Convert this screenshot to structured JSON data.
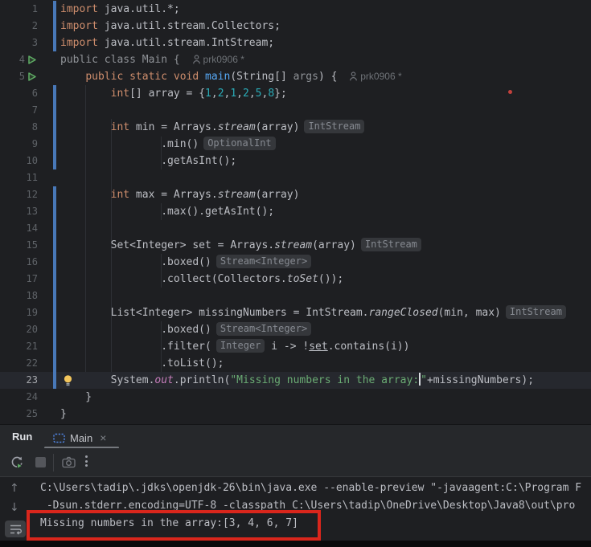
{
  "colors": {
    "editor_bg": "#1e1f22",
    "keyword": "#cf8e6d",
    "string": "#6aab73",
    "number": "#2aacb8",
    "method_decl": "#56a8f5",
    "static_field": "#c77dbb",
    "vcs_change_bar": "#4878b8",
    "run_green": "#5fad65",
    "annotation_red": "#d9261c",
    "current_line_bg": "#26282e"
  },
  "editor": {
    "author_label": "prk0906 *",
    "lines": [
      {
        "n": "1",
        "vcs": true,
        "segs": [
          {
            "s": "kw",
            "t": "import"
          },
          {
            "s": "def",
            "t": " java.util.*;"
          }
        ]
      },
      {
        "n": "2",
        "vcs": true,
        "segs": [
          {
            "s": "kw",
            "t": "import"
          },
          {
            "s": "def",
            "t": " java.util.stream.Collectors;"
          }
        ]
      },
      {
        "n": "3",
        "vcs": true,
        "segs": [
          {
            "s": "kw",
            "t": "import"
          },
          {
            "s": "def",
            "t": " java.util.stream.IntStream;"
          }
        ]
      },
      {
        "n": "4",
        "run": true,
        "segs": [
          {
            "s": "dim",
            "t": "public class Main { "
          },
          {
            "icon": "person-icon"
          },
          {
            "s": "author",
            "t": "prk0906 *"
          }
        ]
      },
      {
        "n": "5",
        "run": true,
        "segs": [
          {
            "s": "def",
            "t": "    "
          },
          {
            "s": "kw",
            "t": "public static void "
          },
          {
            "s": "fn",
            "t": "main"
          },
          {
            "s": "def",
            "t": "(String[] "
          },
          {
            "s": "dim",
            "t": "args"
          },
          {
            "s": "def",
            "t": ") { "
          },
          {
            "icon": "person-icon"
          },
          {
            "s": "author",
            "t": "prk0906 *"
          }
        ]
      },
      {
        "n": "6",
        "vcs": true,
        "segs": [
          {
            "s": "def",
            "t": "        "
          },
          {
            "s": "kw",
            "t": "int"
          },
          {
            "s": "def",
            "t": "[] array = {"
          },
          {
            "s": "num",
            "t": "1"
          },
          {
            "s": "def",
            "t": ","
          },
          {
            "s": "num",
            "t": "2"
          },
          {
            "s": "def",
            "t": ","
          },
          {
            "s": "num",
            "t": "1"
          },
          {
            "s": "def",
            "t": ","
          },
          {
            "s": "num",
            "t": "2"
          },
          {
            "s": "def",
            "t": ","
          },
          {
            "s": "num",
            "t": "5"
          },
          {
            "s": "def",
            "t": ","
          },
          {
            "s": "num",
            "t": "8"
          },
          {
            "s": "def",
            "t": "};"
          }
        ]
      },
      {
        "n": "7",
        "vcs": true,
        "segs": []
      },
      {
        "n": "8",
        "vcs": true,
        "segs": [
          {
            "s": "def",
            "t": "        "
          },
          {
            "s": "kw",
            "t": "int"
          },
          {
            "s": "def",
            "t": " min = Arrays."
          },
          {
            "s": "it",
            "t": "stream"
          },
          {
            "s": "def",
            "t": "(array)"
          },
          {
            "s": "hint",
            "t": "IntStream"
          }
        ]
      },
      {
        "n": "9",
        "vcs": true,
        "segs": [
          {
            "s": "def",
            "t": "                .min()"
          },
          {
            "s": "hint",
            "t": "OptionalInt"
          }
        ]
      },
      {
        "n": "10",
        "vcs": true,
        "segs": [
          {
            "s": "def",
            "t": "                .getAsInt();"
          }
        ]
      },
      {
        "n": "11",
        "segs": []
      },
      {
        "n": "12",
        "vcs": true,
        "segs": [
          {
            "s": "def",
            "t": "        "
          },
          {
            "s": "kw",
            "t": "int"
          },
          {
            "s": "def",
            "t": " max = Arrays."
          },
          {
            "s": "it",
            "t": "stream"
          },
          {
            "s": "def",
            "t": "(array)"
          }
        ]
      },
      {
        "n": "13",
        "vcs": true,
        "segs": [
          {
            "s": "def",
            "t": "                .max().getAsInt();"
          }
        ]
      },
      {
        "n": "14",
        "vcs": true,
        "segs": []
      },
      {
        "n": "15",
        "vcs": true,
        "segs": [
          {
            "s": "def",
            "t": "        Set<Integer> set = Arrays."
          },
          {
            "s": "it",
            "t": "stream"
          },
          {
            "s": "def",
            "t": "(array)"
          },
          {
            "s": "hint",
            "t": "IntStream"
          }
        ]
      },
      {
        "n": "16",
        "vcs": true,
        "segs": [
          {
            "s": "def",
            "t": "                .boxed()"
          },
          {
            "s": "hint",
            "t": "Stream<Integer>"
          }
        ]
      },
      {
        "n": "17",
        "vcs": true,
        "segs": [
          {
            "s": "def",
            "t": "                .collect(Collectors."
          },
          {
            "s": "it",
            "t": "toSet"
          },
          {
            "s": "def",
            "t": "());"
          }
        ]
      },
      {
        "n": "18",
        "vcs": true,
        "segs": []
      },
      {
        "n": "19",
        "vcs": true,
        "segs": [
          {
            "s": "def",
            "t": "        List<Integer> missingNumbers = IntStream."
          },
          {
            "s": "it",
            "t": "rangeClosed"
          },
          {
            "s": "def",
            "t": "(min, max)"
          },
          {
            "s": "hint",
            "t": "IntStream"
          }
        ]
      },
      {
        "n": "20",
        "vcs": true,
        "segs": [
          {
            "s": "def",
            "t": "                .boxed()"
          },
          {
            "s": "hint",
            "t": "Stream<Integer>"
          }
        ]
      },
      {
        "n": "21",
        "vcs": true,
        "segs": [
          {
            "s": "def",
            "t": "                .filter("
          },
          {
            "s": "hint",
            "t": "Integer"
          },
          {
            "s": "def",
            "t": " i -> !"
          },
          {
            "s": "und",
            "t": "set"
          },
          {
            "s": "def",
            "t": ".contains(i))"
          }
        ]
      },
      {
        "n": "22",
        "vcs": true,
        "segs": [
          {
            "s": "def",
            "t": "                .toList();"
          }
        ]
      },
      {
        "n": "23",
        "vcs": true,
        "current": true,
        "bulb": true,
        "segs": [
          {
            "s": "def",
            "t": "        System."
          },
          {
            "s": "field",
            "t": "out"
          },
          {
            "s": "def",
            "t": ".println("
          },
          {
            "s": "str",
            "t": "\"Missing numbers in the array:"
          },
          {
            "s": "caret",
            "t": ""
          },
          {
            "s": "str",
            "t": "\""
          },
          {
            "s": "def",
            "t": "+missingNumbers);"
          }
        ]
      },
      {
        "n": "24",
        "segs": [
          {
            "s": "def",
            "t": "    }"
          }
        ]
      },
      {
        "n": "25",
        "segs": [
          {
            "s": "def",
            "t": "}"
          }
        ]
      }
    ]
  },
  "run_panel": {
    "title": "Run",
    "tab": {
      "icon": "console-icon",
      "label": "Main",
      "close": "×"
    },
    "toolbar_icons": [
      "rerun-icon",
      "stop-icon",
      "thread-dump-icon",
      "more-options-icon"
    ],
    "console_gutter": {
      "up": "↑",
      "down": "↓",
      "wrap_icon": "soft-wrap-icon"
    }
  },
  "console": {
    "lines": [
      "C:\\Users\\tadip\\.jdks\\openjdk-26\\bin\\java.exe --enable-preview \"-javaagent:C:\\Program F",
      " -Dsun.stderr.encoding=UTF-8 -classpath C:\\Users\\tadip\\OneDrive\\Desktop\\Java8\\out\\pro",
      "Missing numbers in the array:[3, 4, 6, 7]"
    ],
    "annotation": {
      "shape": "red-rectangle",
      "highlights_line": "Missing numbers in the array:[3, 4, 6, 7]",
      "color": "#d9261c"
    }
  }
}
